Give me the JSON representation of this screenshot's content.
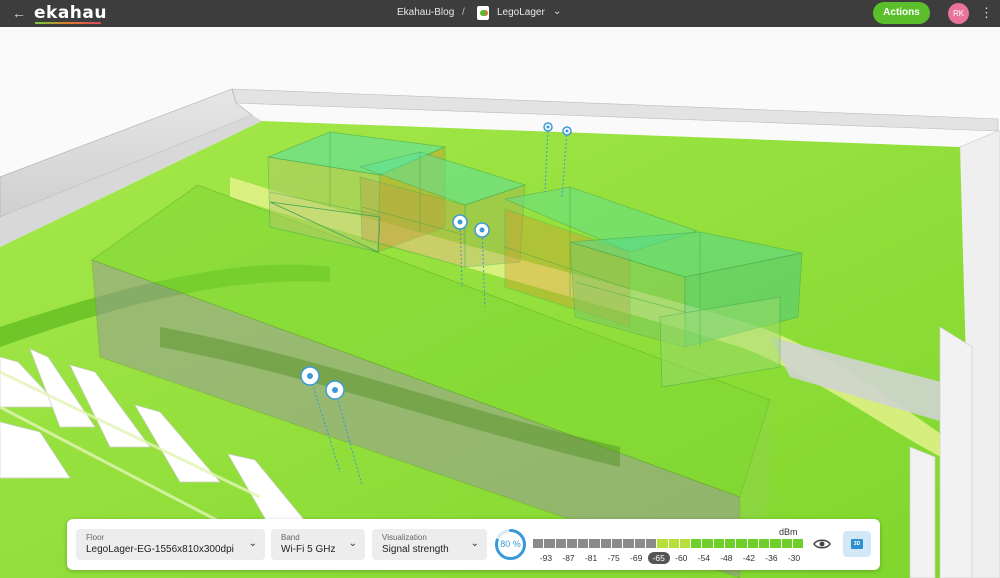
{
  "app": {
    "logo": "ekahau",
    "breadcrumb": {
      "project": "Ekahau-Blog",
      "separator": "/",
      "file": "LegoLager"
    },
    "actions_label": "Actions",
    "avatar_initials": "RK"
  },
  "toolbar": {
    "floor": {
      "label": "Floor",
      "value": "LegoLager-EG-1556x810x300dpi"
    },
    "band": {
      "label": "Band",
      "value": "Wi-Fi 5 GHz"
    },
    "visualization": {
      "label": "Visualization",
      "value": "Signal strength"
    },
    "opacity": "80 %",
    "opacity_fraction": 0.8,
    "unit": "dBm",
    "ticks": [
      "-93",
      "-87",
      "-81",
      "-75",
      "-69",
      "-65",
      "-60",
      "-54",
      "-48",
      "-42",
      "-36",
      "-30"
    ],
    "selected_tick": "-65",
    "button_3d": "3D"
  },
  "colors": {
    "topbar": "#3d3d3d",
    "accent_green": "#5bbf2c",
    "heatmap_green": "#8ee03a",
    "avatar": "#e9739a",
    "access_point": "#3a9ad9"
  },
  "icons": {
    "back": "arrow-left-icon",
    "kebab": "more-vertical-icon",
    "eye": "eye-icon",
    "project": "project-icon",
    "chevron": "chevron-down-icon",
    "view_3d": "cube-3d-icon"
  }
}
